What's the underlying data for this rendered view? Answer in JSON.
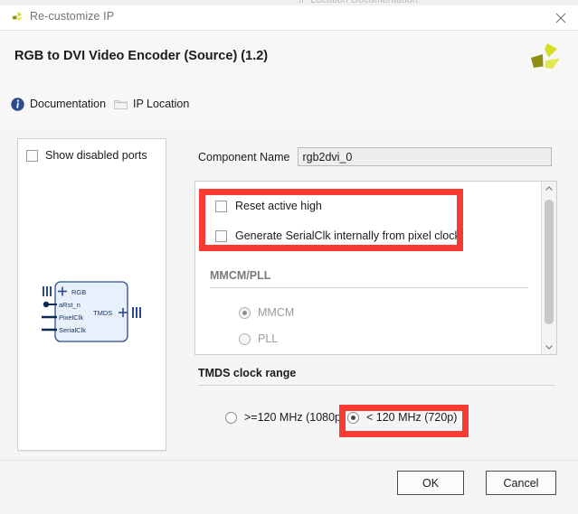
{
  "window": {
    "title": "Re-customize IP",
    "title_icon": "xilinx-logo-icon",
    "close_icon": "close-icon",
    "background_ghost_text": "IP Location"
  },
  "header": {
    "product_title": "RGB to DVI Video Encoder (Source) (1.2)",
    "logo_icon": "xilinx-logo-icon"
  },
  "links": [
    {
      "label": "Documentation",
      "icon": "info-circle-icon"
    },
    {
      "label": "IP Location",
      "icon": "folder-icon"
    }
  ],
  "preview_panel": {
    "show_disabled_ports": {
      "label": "Show disabled ports",
      "checked": false
    },
    "ip_block": {
      "left_ports": [
        "RGB",
        "aRst_n",
        "PixelClk",
        "SerialClk"
      ],
      "right_ports": [
        "TMDS"
      ]
    }
  },
  "component_name": {
    "label": "Component Name",
    "value": "rgb2dvi_0"
  },
  "options": {
    "checkboxes": [
      {
        "label": "Reset active high",
        "checked": false
      },
      {
        "label": "Generate SerialClk internally from pixel clock.",
        "checked": false
      }
    ],
    "group": {
      "title": "MMCM/PLL",
      "enabled": false,
      "radios": [
        {
          "label": "MMCM",
          "selected": true
        },
        {
          "label": "PLL",
          "selected": false
        }
      ]
    },
    "scrollbar": {
      "up_icon": "chevron-up-icon",
      "down_icon": "chevron-down-icon"
    }
  },
  "tmds": {
    "title": "TMDS clock range",
    "radios": [
      {
        "label": ">=120 MHz (1080p)",
        "selected": false
      },
      {
        "label": "< 120 MHz (720p)",
        "selected": true
      }
    ]
  },
  "annotations": {
    "color": "#f93a33",
    "boxes": [
      "checkbox-group-highlight",
      "tmds-720p-highlight"
    ]
  },
  "footer": {
    "ok_label": "OK",
    "cancel_label": "Cancel"
  }
}
